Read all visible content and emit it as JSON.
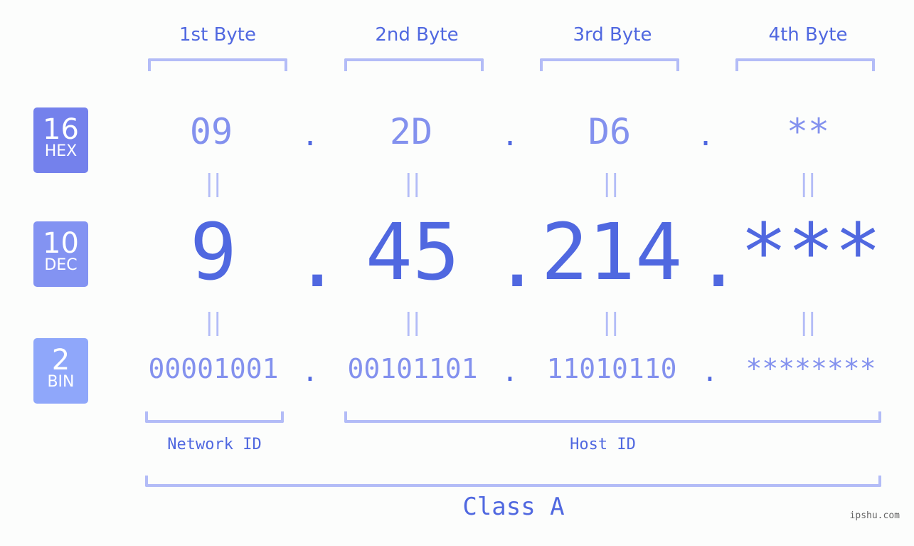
{
  "byte_headers": [
    "1st Byte",
    "2nd Byte",
    "3rd Byte",
    "4th Byte"
  ],
  "badges": {
    "hex": {
      "number": "16",
      "unit": "HEX",
      "color": "#7481ec"
    },
    "dec": {
      "number": "10",
      "unit": "DEC",
      "color": "#8393f2"
    },
    "bin": {
      "number": "2",
      "unit": "BIN",
      "color": "#8fa7fa"
    }
  },
  "hex": [
    "09",
    "2D",
    "D6",
    "**"
  ],
  "dec": [
    "9",
    "45",
    "214",
    "***"
  ],
  "bin": [
    "00001001",
    "00101101",
    "11010110",
    "********"
  ],
  "separator": ".",
  "equals": "||",
  "network_id_label": "Network ID",
  "host_id_label": "Host ID",
  "class_label": "Class A",
  "watermark": "ipshu.com",
  "colors": {
    "accent": "#5068e0",
    "light": "#8391ee",
    "bracket": "#b3bcf7"
  }
}
